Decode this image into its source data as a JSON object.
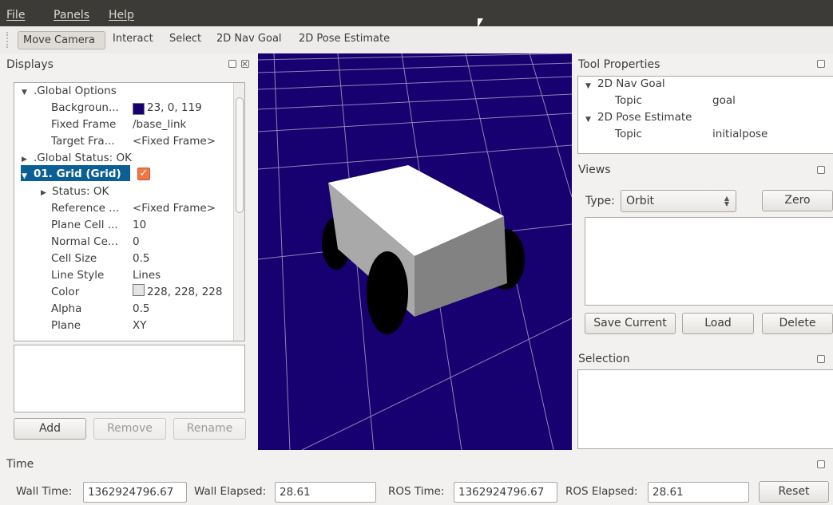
{
  "menu": [
    "File",
    "Panels",
    "Help"
  ],
  "toolbar": {
    "tools": [
      "Move Camera",
      "Interact",
      "Select",
      "2D Nav Goal",
      "2D Pose Estimate"
    ],
    "active": "Move Camera"
  },
  "displays": {
    "title": "Displays",
    "tree": [
      {
        "label": ".Global Options",
        "expanded": true
      },
      {
        "label": "Backgroun...",
        "value": "23, 0, 119",
        "color": "#17006f"
      },
      {
        "label": "Fixed Frame",
        "value": "/base_link"
      },
      {
        "label": "Target Fra...",
        "value": "<Fixed Frame>"
      },
      {
        "label": ".Global Status: OK",
        "collapsed": true
      },
      {
        "label": "01. Grid (Grid)",
        "expanded": true,
        "checked": true
      },
      {
        "label": "Status: OK",
        "collapsed": true
      },
      {
        "label": "Reference ...",
        "value": "<Fixed Frame>"
      },
      {
        "label": "Plane Cell ...",
        "value": "10"
      },
      {
        "label": "Normal Ce...",
        "value": "0"
      },
      {
        "label": "Cell Size",
        "value": "0.5"
      },
      {
        "label": "Line Style",
        "value": "Lines"
      },
      {
        "label": "Color",
        "value": "228, 228, 228",
        "color": "#e4e4e4"
      },
      {
        "label": "Alpha",
        "value": "0.5"
      },
      {
        "label": "Plane",
        "value": "XY"
      }
    ],
    "buttons": {
      "add": "Add",
      "remove": "Remove",
      "rename": "Rename"
    }
  },
  "tool_properties": {
    "title": "Tool Properties",
    "groups": [
      {
        "name": "2D Nav Goal",
        "prop": "Topic",
        "value": "goal"
      },
      {
        "name": "2D Pose Estimate",
        "prop": "Topic",
        "value": "initialpose"
      }
    ]
  },
  "views": {
    "title": "Views",
    "type_label": "Type:",
    "type_value": "Orbit",
    "zero": "Zero",
    "save": "Save Current",
    "load": "Load",
    "delete": "Delete"
  },
  "selection": {
    "title": "Selection"
  },
  "time": {
    "title": "Time",
    "wall_time_label": "Wall Time:",
    "wall_time": "1362924796.67",
    "wall_elapsed_label": "Wall Elapsed:",
    "wall_elapsed": "28.61",
    "ros_time_label": "ROS Time:",
    "ros_time": "1362924796.67",
    "ros_elapsed_label": "ROS Elapsed:",
    "ros_elapsed": "28.61",
    "reset": "Reset"
  },
  "colors": {
    "viewport_background": "#17006f",
    "selection_highlight": "#0c5f94",
    "checkbox": "#f07746",
    "menubar": "#3c3b37"
  }
}
